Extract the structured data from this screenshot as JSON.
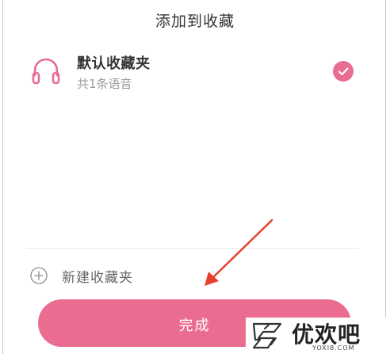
{
  "dialog": {
    "title": "添加到收藏"
  },
  "folder": {
    "name": "默认收藏夹",
    "count_text": "共1条语音",
    "selected": true,
    "icon": "headphone-icon"
  },
  "new_folder": {
    "label": "新建收藏夹",
    "icon": "plus-circle-icon"
  },
  "actions": {
    "done_label": "完成"
  },
  "annotation": {
    "arrow_color": "#e8402c"
  },
  "watermark": {
    "brand": "优欢吧",
    "url": "YOXI8.COM"
  },
  "colors": {
    "accent": "#ea6d91",
    "text_primary": "#333333",
    "text_secondary": "#9c9c9c"
  }
}
